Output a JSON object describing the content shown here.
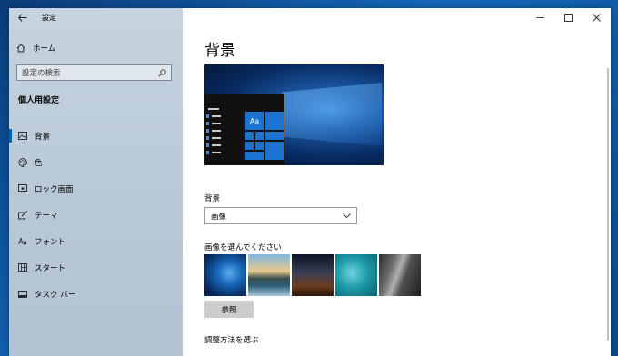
{
  "window": {
    "title": "設定"
  },
  "sidebar": {
    "home_label": "ホーム",
    "search_placeholder": "設定の検索",
    "section_title": "個人用設定",
    "items": [
      {
        "label": "背景",
        "icon": "picture-icon",
        "active": true
      },
      {
        "label": "色",
        "icon": "palette-icon"
      },
      {
        "label": "ロック画面",
        "icon": "lock-screen-icon"
      },
      {
        "label": "テーマ",
        "icon": "theme-brush-icon"
      },
      {
        "label": "フォント",
        "icon": "font-icon"
      },
      {
        "label": "スタート",
        "icon": "start-tiles-icon"
      },
      {
        "label": "タスク バー",
        "icon": "taskbar-icon"
      }
    ]
  },
  "main": {
    "page_title": "背景",
    "preview_tile_label": "Aa",
    "background_label": "背景",
    "background_value": "画像",
    "choose_picture_label": "画像を選んでください",
    "thumbnails": [
      "windows-hero-blue",
      "beach-rocks-sunset",
      "night-sky-milky-way",
      "underwater-swimmer",
      "rock-cliff-coast"
    ],
    "browse_label": "参照",
    "fit_label": "調整方法を選ぶ"
  },
  "colors": {
    "accent": "#0063b1",
    "sidebar_bg": "#bccbd9",
    "tile_blue": "#1a73d0"
  }
}
